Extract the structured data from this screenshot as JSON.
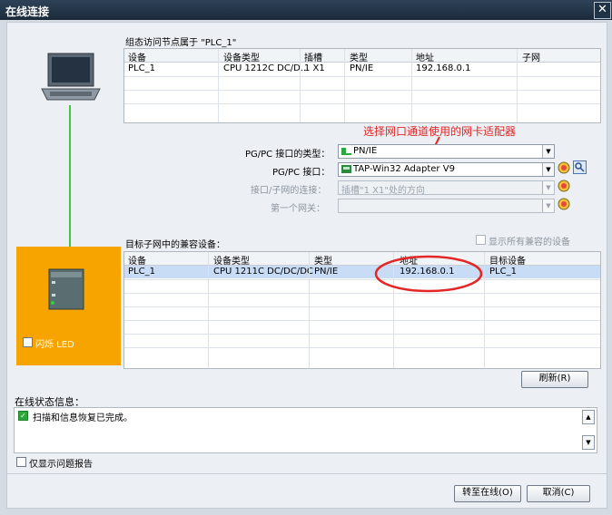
{
  "window": {
    "title": "在线连接",
    "close_glyph": "✕"
  },
  "device_table": {
    "caption": "组态访问节点属于 \"PLC_1\"",
    "columns": [
      "设备",
      "设备类型",
      "插槽",
      "类型",
      "地址",
      "子网"
    ],
    "rows": [
      [
        "PLC_1",
        "CPU 1212C DC/D...",
        "1 X1",
        "PN/IE",
        "192.168.0.1",
        ""
      ]
    ]
  },
  "annotation": {
    "text": "选择网口通道使用的网卡适配器",
    "color": "#e32626"
  },
  "form": {
    "pgpc_type": {
      "label": "PG/PC 接口的类型：",
      "value": "PN/IE"
    },
    "pgpc_if": {
      "label": "PG/PC 接口：",
      "value": "TAP-Win32 Adapter V9"
    },
    "subnet_conn": {
      "label": "接口/子网的连接：",
      "value": "插槽\"1 X1\"处的方向"
    },
    "gateway": {
      "label": "第一个网关：",
      "value": ""
    }
  },
  "compat": {
    "caption": "目标子网中的兼容设备：",
    "show_all": "显示所有兼容的设备",
    "columns": [
      "设备",
      "设备类型",
      "类型",
      "地址",
      "目标设备"
    ],
    "rows": [
      [
        "PLC_1",
        "CPU 1211C DC/DC/DC",
        "PN/IE",
        "192.168.0.1",
        "PLC_1"
      ]
    ]
  },
  "flash_led": "闪烁 LED",
  "refresh_btn": "刷新(R)",
  "status": {
    "caption": "在线状态信息：",
    "message": "扫描和信息恢复已完成。",
    "only_errors": "仅显示问题报告"
  },
  "buttons": {
    "go_online": "转至在线(O)",
    "cancel": "取消(C)"
  },
  "colors": {
    "orange_panel": "#f7a400",
    "link_line": "#43c443",
    "title_bar": "#22334a",
    "selection": "#c9dcf5"
  }
}
